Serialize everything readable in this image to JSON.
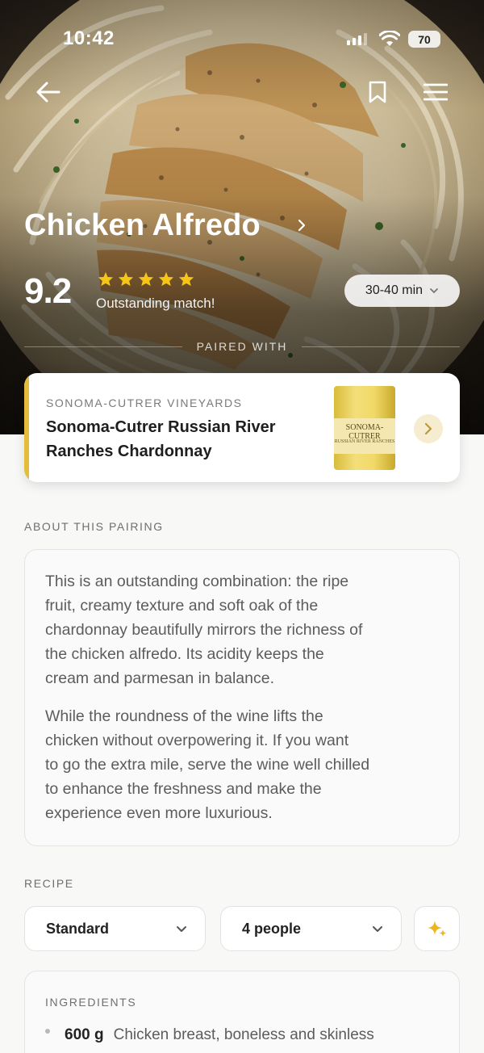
{
  "status_bar": {
    "time": "10:42",
    "battery": "70"
  },
  "hero": {
    "title": "Chicken Alfredo",
    "score": "9.2",
    "stars": 5,
    "match_text": "Outstanding match!",
    "time_filter": "30-40 min",
    "paired_label": "PAIRED WITH"
  },
  "wine": {
    "winery": "SONOMA-CUTRER VINEYARDS",
    "name_line1": "Sonoma-Cutrer Russian River",
    "name_line2": "Ranches Chardonnay",
    "bottle_label": "SONOMA-CUTRER",
    "bottle_sub": "RUSSIAN RIVER RANCHES",
    "accent_color": "#e4bd3a"
  },
  "about": {
    "label": "ABOUT THIS PAIRING",
    "para1_lines": [
      "This is an outstanding combination: the ripe",
      "fruit, creamy texture and soft oak of the",
      "chardonnay beautifully mirrors the richness of",
      "the chicken alfredo. Its acidity keeps the",
      "cream and parmesan in balance."
    ],
    "para2_lines": [
      "While the roundness of the wine lifts the",
      "chicken without overpowering it. If you want",
      "to go the extra mile, serve the wine well chilled",
      "to enhance the freshness and make the",
      "experience even more luxurious."
    ]
  },
  "recipe": {
    "label": "RECIPE",
    "style_select": "Standard",
    "people_select": "4 people",
    "ingredients_label": "INGREDIENTS",
    "ingredients": [
      {
        "qty": "600 g",
        "name": "Chicken breast, boneless and skinless"
      }
    ]
  },
  "icons": {
    "back": "arrow-left-icon",
    "bookmark": "bookmark-icon",
    "menu": "hamburger-menu-icon",
    "sparkle": "sparkle-icon"
  }
}
